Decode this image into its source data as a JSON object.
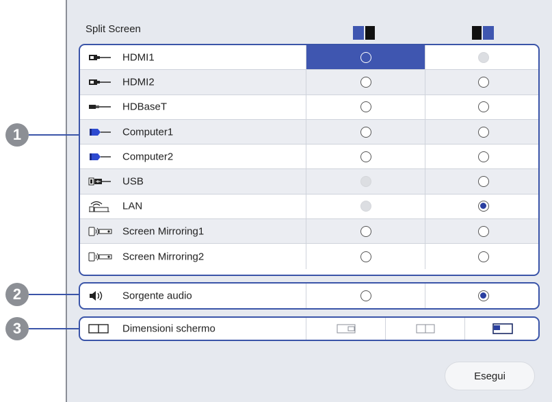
{
  "title": "Split Screen",
  "header_icons": [
    "layout-left-active-icon",
    "layout-right-active-icon"
  ],
  "sources": [
    {
      "label": "HDMI1",
      "icon": "hdmi-icon",
      "left": "selected",
      "right": "disabled"
    },
    {
      "label": "HDMI2",
      "icon": "hdmi-icon",
      "left": "empty",
      "right": "empty"
    },
    {
      "label": "HDBaseT",
      "icon": "hdbaset-icon",
      "left": "empty",
      "right": "empty"
    },
    {
      "label": "Computer1",
      "icon": "computer-icon",
      "left": "empty",
      "right": "empty"
    },
    {
      "label": "Computer2",
      "icon": "computer-icon",
      "left": "empty",
      "right": "empty"
    },
    {
      "label": "USB",
      "icon": "usb-icon",
      "left": "disabled",
      "right": "empty"
    },
    {
      "label": "LAN",
      "icon": "lan-icon",
      "left": "disabled",
      "right": "checked"
    },
    {
      "label": "Screen Mirroring1",
      "icon": "screen-mirroring-icon",
      "left": "empty",
      "right": "empty"
    },
    {
      "label": "Screen Mirroring2",
      "icon": "screen-mirroring-icon",
      "left": "empty",
      "right": "empty"
    }
  ],
  "audio": {
    "label": "Sorgente audio",
    "left": "empty",
    "right": "checked"
  },
  "screen_size": {
    "label": "Dimensioni schermo",
    "options": [
      "left-larger-icon",
      "equal-size-icon",
      "right-larger-icon"
    ],
    "selected_index": 2
  },
  "callouts": [
    "1",
    "2",
    "3"
  ],
  "execute_label": "Esegui",
  "colors": {
    "accent": "#3f56b0",
    "panel": "#e6e9ef",
    "border": "#3a54a8"
  }
}
